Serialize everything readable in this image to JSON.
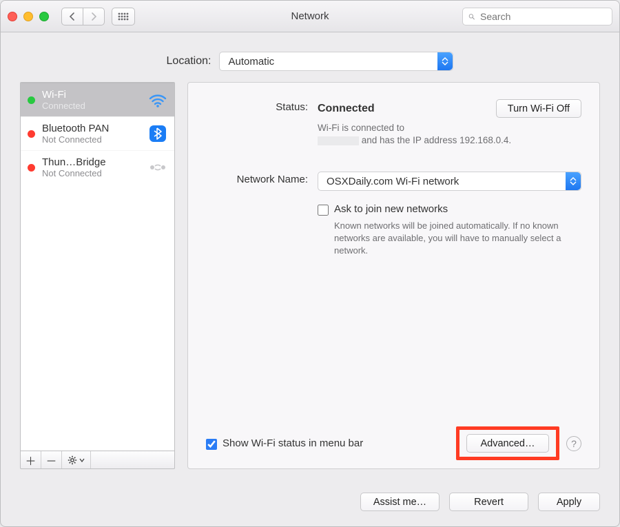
{
  "toolbar": {
    "title": "Network",
    "search_placeholder": "Search"
  },
  "location": {
    "label": "Location:",
    "value": "Automatic"
  },
  "sidebar": {
    "items": [
      {
        "name": "Wi-Fi",
        "status": "Connected",
        "connected": true,
        "icon": "wifi"
      },
      {
        "name": "Bluetooth PAN",
        "status": "Not Connected",
        "connected": false,
        "icon": "bluetooth"
      },
      {
        "name": "Thun…Bridge",
        "status": "Not Connected",
        "connected": false,
        "icon": "bridge"
      }
    ]
  },
  "detail": {
    "status_label": "Status:",
    "status_value": "Connected",
    "wifi_toggle_label": "Turn Wi-Fi Off",
    "status_sub_prefix": "Wi-Fi is connected to",
    "status_sub_suffix": "and has the IP address 192.168.0.4.",
    "nn_label": "Network Name:",
    "nn_value": "OSXDaily.com Wi-Fi network",
    "ask_label": "Ask to join new networks",
    "ask_desc": "Known networks will be joined automatically. If no known networks are available, you will have to manually select a network.",
    "show_status_label": "Show Wi-Fi status in menu bar",
    "advanced_label": "Advanced…"
  },
  "footer": {
    "assist": "Assist me…",
    "revert": "Revert",
    "apply": "Apply"
  }
}
